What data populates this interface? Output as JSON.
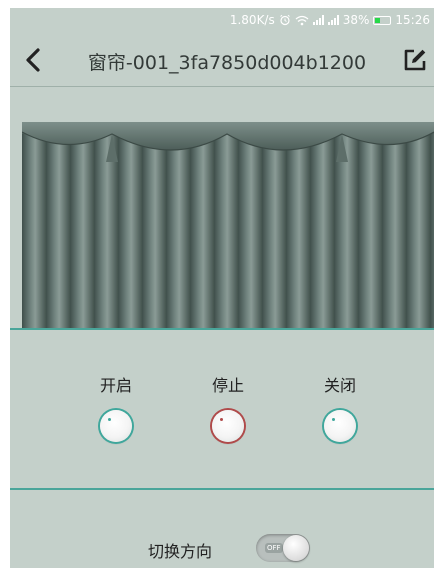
{
  "status_bar": {
    "speed": "1.80K/s",
    "battery_percent": "38%",
    "battery_level": 0.38,
    "time": "15:26",
    "icons": [
      "alarm-icon",
      "wifi-icon",
      "signal-icon",
      "signal-icon",
      "battery-icon"
    ]
  },
  "header": {
    "title": "窗帘-001_3fa7850d004b1200",
    "back_icon": "chevron-left-icon",
    "edit_icon": "edit-icon"
  },
  "controls": [
    {
      "label": "开启",
      "ring_color": "#3fa79c"
    },
    {
      "label": "停止",
      "ring_color": "#b04a4a"
    },
    {
      "label": "关闭",
      "ring_color": "#3fa79c"
    }
  ],
  "direction": {
    "label": "切换方向",
    "switch_text": "OFF",
    "state": "off"
  },
  "colors": {
    "background": "#c4d0ca",
    "accent": "#4aa59a",
    "curtain": "#5c6e69",
    "stop": "#b04a4a"
  }
}
